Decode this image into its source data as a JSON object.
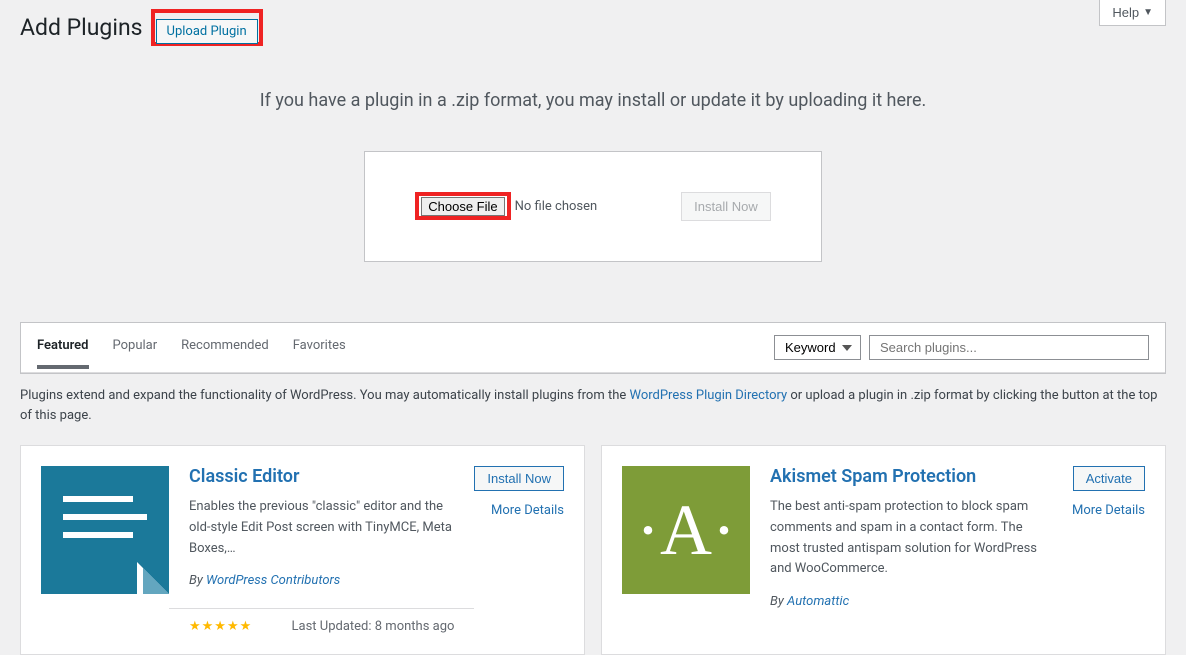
{
  "help_label": "Help",
  "page_title": "Add Plugins",
  "upload_plugin_label": "Upload Plugin",
  "upload_instruction": "If you have a plugin in a .zip format, you may install or update it by uploading it here.",
  "choose_file_label": "Choose File",
  "no_file_text": "No file chosen",
  "install_now_upload": "Install Now",
  "filter_tabs": {
    "featured": "Featured",
    "popular": "Popular",
    "recommended": "Recommended",
    "favorites": "Favorites"
  },
  "search_type_label": "Keyword",
  "search_placeholder": "Search plugins...",
  "intro_text_1": "Plugins extend and expand the functionality of WordPress. You may automatically install plugins from the ",
  "intro_link": "WordPress Plugin Directory",
  "intro_text_2": " or upload a plugin in .zip format by clicking the button at the top of this page.",
  "plugins": [
    {
      "name": "Classic Editor",
      "desc": "Enables the previous \"classic\" editor and the old-style Edit Post screen with TinyMCE, Meta Boxes,…",
      "author_prefix": "By ",
      "author": "WordPress Contributors",
      "action": "Install Now",
      "more": "More Details",
      "last_updated": "Last Updated: 8 months ago"
    },
    {
      "name": "Akismet Spam Protection",
      "desc": "The best anti-spam protection to block spam comments and spam in a contact form. The most trusted antispam solution for WordPress and WooCommerce.",
      "author_prefix": "By ",
      "author": "Automattic",
      "action": "Activate",
      "more": "More Details"
    }
  ]
}
